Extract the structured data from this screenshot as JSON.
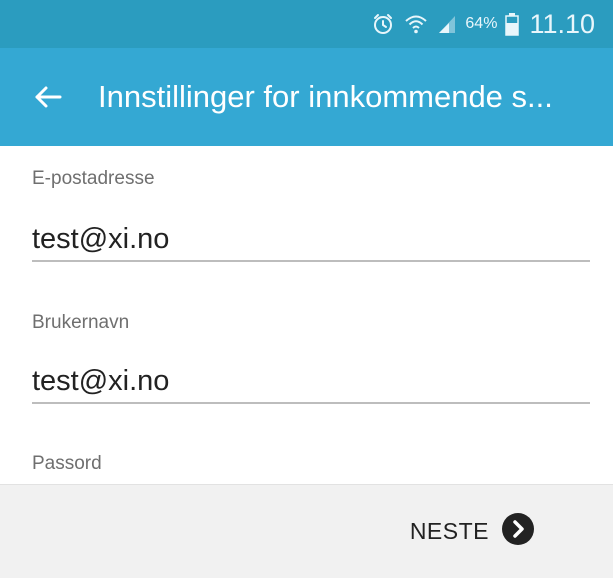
{
  "status_bar": {
    "icons": [
      "alarm-icon",
      "wifi-icon",
      "signal-icon",
      "battery-icon"
    ],
    "battery_percent": "64%",
    "time": "11.10"
  },
  "app_bar": {
    "back_icon": "arrow-left-icon",
    "title": "Innstillinger for innkommende s..."
  },
  "form": {
    "email": {
      "label": "E-postadresse",
      "value": "test@xi.no"
    },
    "username": {
      "label": "Brukernavn",
      "value": "test@xi.no"
    },
    "password": {
      "label": "Passord"
    }
  },
  "bottom_bar": {
    "next_label": "NESTE",
    "next_icon": "chevron-right-circle-icon"
  },
  "colors": {
    "status_bar": "#2b9cbf",
    "app_bar": "#34a8d3",
    "background": "#ffffff",
    "bottom_bar": "#f1f1f1"
  }
}
